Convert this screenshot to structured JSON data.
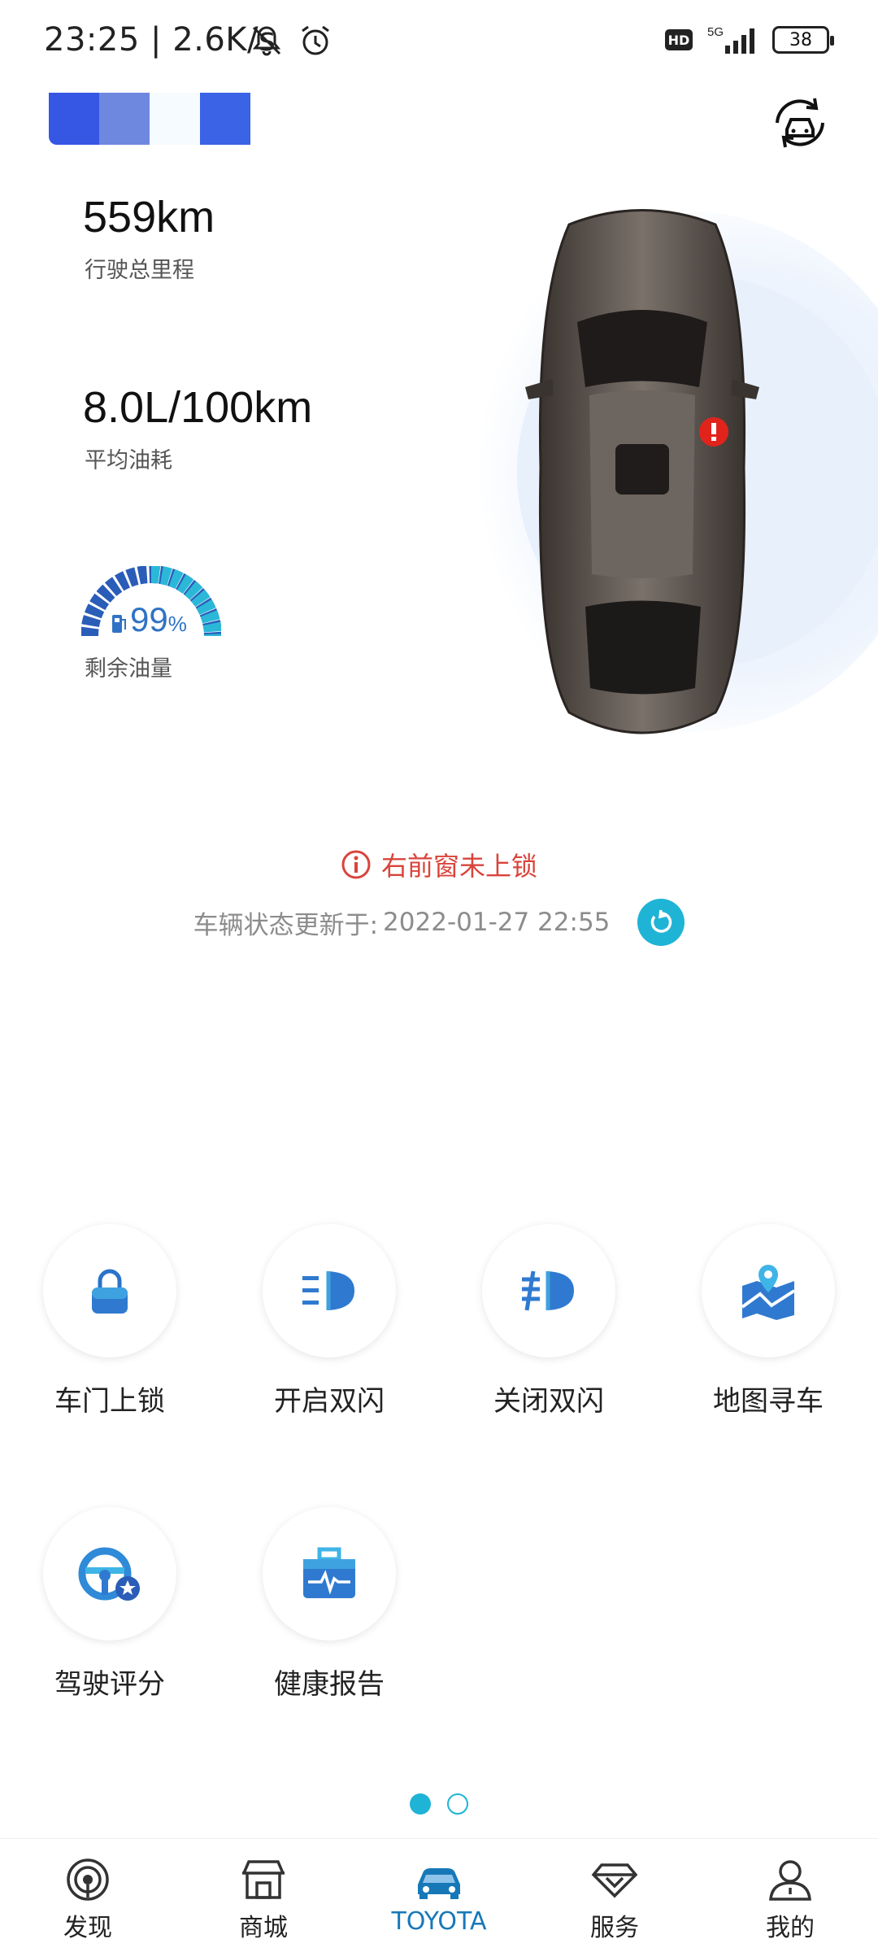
{
  "status_bar": {
    "time": "23:25",
    "speed": "| 2.6K/s",
    "network": "5G",
    "hd": "HD",
    "battery": "38"
  },
  "vehicle_stats": {
    "mileage_value": "559km",
    "mileage_label": "行驶总里程",
    "fuel_consumption_value": "8.0L/100km",
    "fuel_consumption_label": "平均油耗",
    "fuel_level_value": "99",
    "fuel_level_unit": "%",
    "fuel_level_fraction": 0.99,
    "fuel_level_label": "剩余油量"
  },
  "alert": {
    "text": "右前窗未上锁",
    "color": "#d9443b"
  },
  "update": {
    "label": "车辆状态更新于:",
    "time": "2022-01-27 22:55"
  },
  "actions": [
    {
      "label": "车门上锁",
      "icon": "lock-icon"
    },
    {
      "label": "开启双闪",
      "icon": "hazard-on-icon"
    },
    {
      "label": "关闭双闪",
      "icon": "hazard-off-icon"
    },
    {
      "label": "地图寻车",
      "icon": "map-pin-icon"
    },
    {
      "label": "驾驶评分",
      "icon": "steering-wheel-icon"
    },
    {
      "label": "健康报告",
      "icon": "health-report-icon"
    }
  ],
  "pager": {
    "pages": 2,
    "current": 1
  },
  "bottom_nav": [
    {
      "label": "发现",
      "icon": "discover-icon"
    },
    {
      "label": "商城",
      "icon": "store-icon"
    },
    {
      "label": "TOYOTA",
      "icon": "car-icon",
      "active": true
    },
    {
      "label": "服务",
      "icon": "diamond-icon"
    },
    {
      "label": "我的",
      "icon": "profile-icon"
    }
  ],
  "colors": {
    "accent": "#1fb4d6",
    "nav_active": "#1778b8",
    "alert": "#d9443b"
  }
}
